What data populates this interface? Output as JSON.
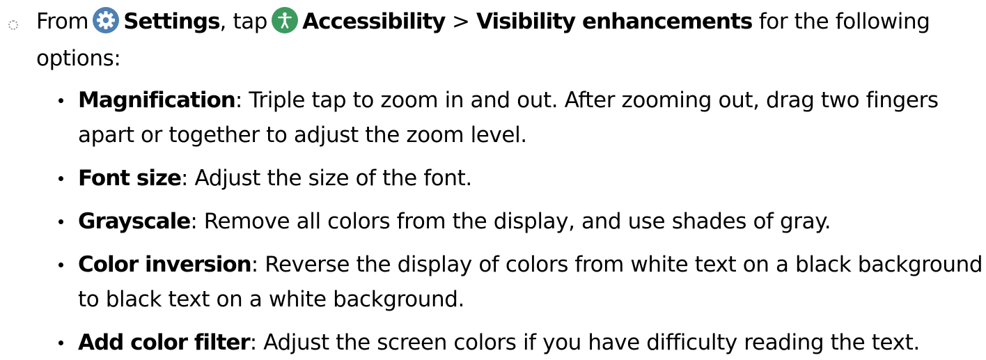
{
  "step": {
    "from_text": "From",
    "settings_icon": "gear-icon",
    "settings_label": "Settings",
    "tap_text": ", tap",
    "accessibility_icon": "accessibility-person-icon",
    "accessibility_label": "Accessibility",
    "separator": ">",
    "visibility_label": "Visibility enhancements",
    "tail_text": "for the following options:"
  },
  "colors": {
    "settings_icon_bg": "#4f80b4",
    "accessibility_icon_bg": "#3c9a5f",
    "text": "#000000"
  },
  "options": [
    {
      "name": "Magnification",
      "description": ": Triple tap to zoom in and out. After zooming out, drag two fingers apart or together to adjust the zoom level."
    },
    {
      "name": "Font size",
      "description": ": Adjust the size of the font."
    },
    {
      "name": "Grayscale",
      "description": ": Remove all colors from the display, and use shades of gray."
    },
    {
      "name": "Color inversion",
      "description": ": Reverse the display of colors from white text on a black background to black text on a white background."
    },
    {
      "name": "Add color filter",
      "description": ": Adjust the screen colors if you have difficulty reading the text."
    }
  ]
}
